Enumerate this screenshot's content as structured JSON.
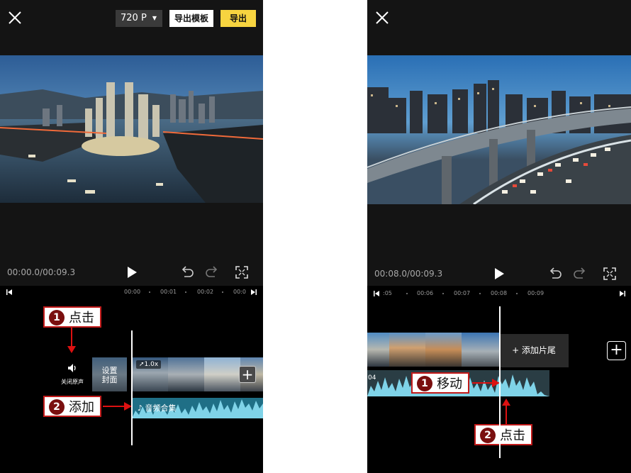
{
  "left": {
    "resolution": "720 P",
    "export_template_label": "导出模板",
    "export_label": "导出",
    "time_display": "00:00.0/00:09.3",
    "ruler_labels": [
      "00:00",
      "00:01",
      "00:02",
      "00:0"
    ],
    "mute_label": "关闭原声",
    "cover_label_line1": "设置",
    "cover_label_line2": "封面",
    "speed_badge": "1.0x",
    "audio_label": "音频合集",
    "callout1": {
      "num": "1",
      "text": "点击"
    },
    "callout2": {
      "num": "2",
      "text": "添加"
    }
  },
  "right": {
    "time_display": "00:08.0/00:09.3",
    "ruler_labels": [
      ":05",
      "00:06",
      "00:07",
      "00:08",
      "00:09"
    ],
    "add_ending_label": "+ 添加片尾",
    "audio_partial_text": "04",
    "callout1": {
      "num": "1",
      "text": "移动"
    },
    "callout2": {
      "num": "2",
      "text": "点击"
    }
  },
  "colors": {
    "panel_bg": "#141414",
    "accent_yellow": "#f7d440",
    "callout_red": "#c21a1a",
    "audio_teal": "#1f6f86",
    "wave_light": "#7fd3e8"
  },
  "icons": [
    "close-icon",
    "caret-down-icon",
    "play-icon",
    "undo-icon",
    "redo-icon",
    "fullscreen-icon",
    "jump-start-icon",
    "jump-end-icon",
    "speaker-icon",
    "plus-icon",
    "music-note-icon"
  ]
}
